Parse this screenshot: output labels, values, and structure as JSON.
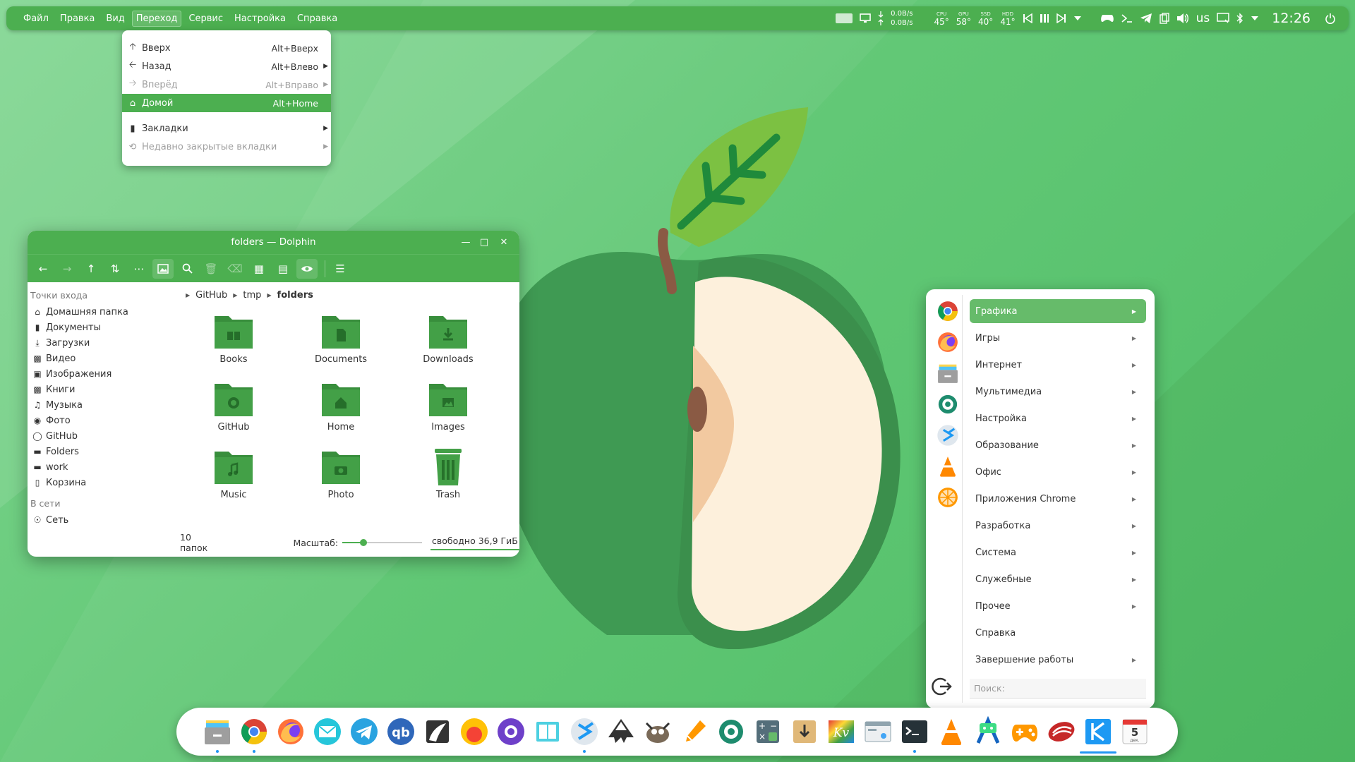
{
  "colors": {
    "accent": "#4caf50",
    "highlight": "#66bb6a",
    "folder": "#43a047",
    "dock_indicator": "#2196f3"
  },
  "menubar": [
    {
      "label": "Файл",
      "active": false
    },
    {
      "label": "Правка",
      "active": false
    },
    {
      "label": "Вид",
      "active": false
    },
    {
      "label": "Переход",
      "active": true
    },
    {
      "label": "Сервис",
      "active": false
    },
    {
      "label": "Настройка",
      "active": false
    },
    {
      "label": "Справка",
      "active": false
    }
  ],
  "tray": {
    "net_down": "0.0B/s",
    "net_up": "0.0B/s",
    "temps": [
      {
        "label": "CPU",
        "value": "45°"
      },
      {
        "label": "GPU",
        "value": "58°"
      },
      {
        "label": "SSD",
        "value": "40°"
      },
      {
        "label": "HDD",
        "value": "41°"
      }
    ],
    "kb_layout": "us",
    "clock": "12:26"
  },
  "go_menu": {
    "items": [
      {
        "icon": "arrow-up-icon",
        "label": "Вверх",
        "shortcut": "Alt+Вверх",
        "disabled": false,
        "highlight": false,
        "submenu": false
      },
      {
        "icon": "arrow-left-icon",
        "label": "Назад",
        "shortcut": "Alt+Влево",
        "disabled": false,
        "highlight": false,
        "submenu": true
      },
      {
        "icon": "arrow-right-icon",
        "label": "Вперёд",
        "shortcut": "Alt+Вправо",
        "disabled": true,
        "highlight": false,
        "submenu": true
      },
      {
        "icon": "home-icon",
        "label": "Домой",
        "shortcut": "Alt+Home",
        "disabled": false,
        "highlight": true,
        "submenu": false
      },
      {
        "icon": "bookmark-icon",
        "label": "Закладки",
        "shortcut": "",
        "disabled": false,
        "highlight": false,
        "submenu": true,
        "sep_before": true
      },
      {
        "icon": "undo-icon",
        "label": "Недавно закрытые вкладки",
        "shortcut": "",
        "disabled": true,
        "highlight": false,
        "submenu": true
      }
    ]
  },
  "dolphin": {
    "title": "folders — Dolphin",
    "sidebar": {
      "places_header": "Точки входа",
      "places": [
        {
          "icon": "home-icon",
          "label": "Домашняя папка"
        },
        {
          "icon": "document-icon",
          "label": "Документы"
        },
        {
          "icon": "download-icon",
          "label": "Загрузки"
        },
        {
          "icon": "video-icon",
          "label": "Видео"
        },
        {
          "icon": "image-icon",
          "label": "Изображения"
        },
        {
          "icon": "book-icon",
          "label": "Книги"
        },
        {
          "icon": "music-icon",
          "label": "Музыка"
        },
        {
          "icon": "camera-icon",
          "label": "Фото"
        },
        {
          "icon": "github-icon",
          "label": "GitHub"
        },
        {
          "icon": "folder-icon",
          "label": "Folders"
        },
        {
          "icon": "folder-icon",
          "label": "work"
        },
        {
          "icon": "trash-icon",
          "label": "Корзина"
        }
      ],
      "network_header": "В сети",
      "network": [
        {
          "icon": "network-icon",
          "label": "Сеть"
        }
      ]
    },
    "breadcrumb": [
      "GitHub",
      "tmp",
      "folders"
    ],
    "folders": [
      {
        "name": "Books",
        "glyph": "book"
      },
      {
        "name": "Documents",
        "glyph": "doc"
      },
      {
        "name": "Downloads",
        "glyph": "download"
      },
      {
        "name": "GitHub",
        "glyph": "github"
      },
      {
        "name": "Home",
        "glyph": "home"
      },
      {
        "name": "Images",
        "glyph": "image"
      },
      {
        "name": "Music",
        "glyph": "music"
      },
      {
        "name": "Photo",
        "glyph": "camera"
      },
      {
        "name": "Trash",
        "glyph": "trash"
      }
    ],
    "status": {
      "count": "10 папок",
      "zoom_label": "Масштаб:",
      "zoom_level": 0.25,
      "free_space": "свободно 36,9 ГиБ"
    }
  },
  "app_menu": {
    "favorites": [
      "chrome-icon",
      "firefox-icon",
      "archive-icon",
      "settings-gear-icon",
      "kde-connect-icon",
      "vlc-icon",
      "orange-icon"
    ],
    "categories": [
      {
        "label": "Графика",
        "submenu": true,
        "selected": true
      },
      {
        "label": "Игры",
        "submenu": true
      },
      {
        "label": "Интернет",
        "submenu": true
      },
      {
        "label": "Мультимедиа",
        "submenu": true
      },
      {
        "label": "Настройка",
        "submenu": true
      },
      {
        "label": "Образование",
        "submenu": true
      },
      {
        "label": "Офис",
        "submenu": true
      },
      {
        "label": "Приложения Chrome",
        "submenu": true
      },
      {
        "label": "Разработка",
        "submenu": true
      },
      {
        "label": "Система",
        "submenu": true
      },
      {
        "label": "Служебные",
        "submenu": true
      },
      {
        "label": "Прочее",
        "submenu": true
      },
      {
        "label": "Справка",
        "submenu": false
      },
      {
        "label": "Завершение работы",
        "submenu": true
      }
    ],
    "search_placeholder": "Поиск:"
  },
  "dock": {
    "calendar_day": "5",
    "calendar_month": "дек.",
    "apps": [
      {
        "id": "file-manager-icon",
        "running": true
      },
      {
        "id": "chrome-icon",
        "running": true
      },
      {
        "id": "firefox-icon",
        "running": false
      },
      {
        "id": "mail-icon",
        "running": false
      },
      {
        "id": "telegram-icon",
        "running": false
      },
      {
        "id": "qbittorrent-icon",
        "running": false
      },
      {
        "id": "publisher-icon",
        "running": false
      },
      {
        "id": "red-circle-icon",
        "running": false
      },
      {
        "id": "github-desktop-icon",
        "running": false
      },
      {
        "id": "ebook-reader-icon",
        "running": false
      },
      {
        "id": "kde-connect-icon",
        "running": true
      },
      {
        "id": "inkscape-icon",
        "running": false
      },
      {
        "id": "gimp-icon",
        "running": false
      },
      {
        "id": "color-picker-icon",
        "running": false
      },
      {
        "id": "settings-gear-icon",
        "running": false
      },
      {
        "id": "calculator-icon",
        "running": false
      },
      {
        "id": "archive-manager-icon",
        "running": false
      },
      {
        "id": "kivy-icon",
        "running": false
      },
      {
        "id": "system-monitor-icon",
        "running": false
      },
      {
        "id": "terminal-icon",
        "running": true
      },
      {
        "id": "vlc-icon",
        "running": false
      },
      {
        "id": "android-studio-icon",
        "running": false
      },
      {
        "id": "gamepad-icon",
        "running": false
      },
      {
        "id": "stacer-icon",
        "running": false
      },
      {
        "id": "kde-launcher-icon",
        "running": true,
        "active": true
      },
      {
        "id": "calendar-icon",
        "running": false
      }
    ]
  }
}
